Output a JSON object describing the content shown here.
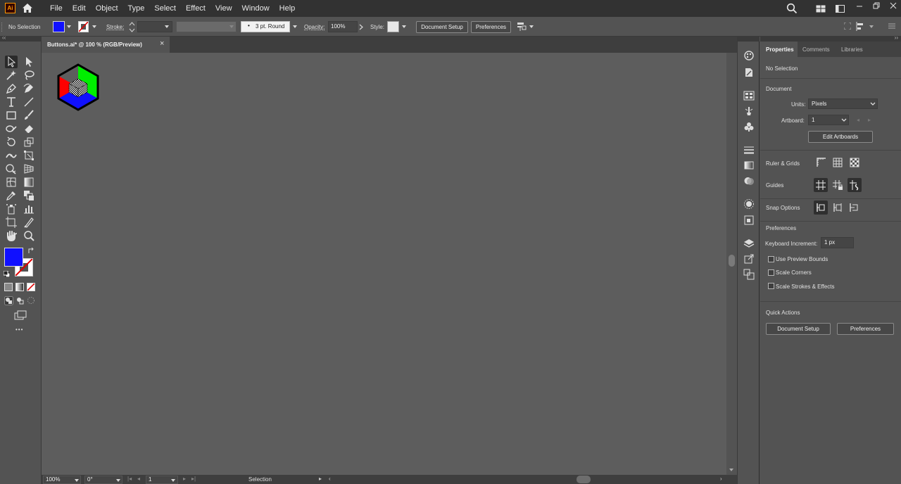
{
  "app": {
    "logo_text": "Ai",
    "logo_border_color": "#ff9a00"
  },
  "menu": [
    "File",
    "Edit",
    "Object",
    "Type",
    "Select",
    "Effect",
    "View",
    "Window",
    "Help"
  ],
  "control_bar": {
    "selection_status": "No Selection",
    "fill_color": "#1010ff",
    "stroke_label": "Stroke:",
    "brush_value": "3 pt. Round",
    "opacity_label": "Opacity:",
    "opacity_value": "100%",
    "style_label": "Style:",
    "document_setup_label": "Document Setup",
    "preferences_label": "Preferences"
  },
  "document_tab": {
    "title": "Buttons.ai* @ 100 % (RGB/Preview)",
    "close_glyph": "×"
  },
  "toolbar": {
    "fill_color": "#1010ff",
    "more_glyph": "•••"
  },
  "status_bar": {
    "zoom": "100%",
    "rotation": "0°",
    "artboard": "1",
    "tool": "Selection"
  },
  "properties": {
    "tabs": [
      "Properties",
      "Comments",
      "Libraries"
    ],
    "selection_status": "No Selection",
    "document_heading": "Document",
    "units_label": "Units:",
    "units_value": "Pixels",
    "artboard_label": "Artboard:",
    "artboard_value": "1",
    "edit_artboards_label": "Edit Artboards",
    "ruler_grids_label": "Ruler & Grids",
    "guides_label": "Guides",
    "snap_options_label": "Snap Options",
    "preferences_heading": "Preferences",
    "keyboard_increment_label": "Keyboard Increment:",
    "keyboard_increment_value": "1 px",
    "checkboxes": [
      "Use Preview Bounds",
      "Scale Corners",
      "Scale Strokes & Effects"
    ],
    "quick_actions_heading": "Quick Actions",
    "document_setup_label": "Document Setup",
    "preferences_label": "Preferences"
  },
  "artwork": {
    "colors": {
      "red": "#ff0000",
      "green": "#00ee00",
      "blue": "#1010ff"
    }
  }
}
